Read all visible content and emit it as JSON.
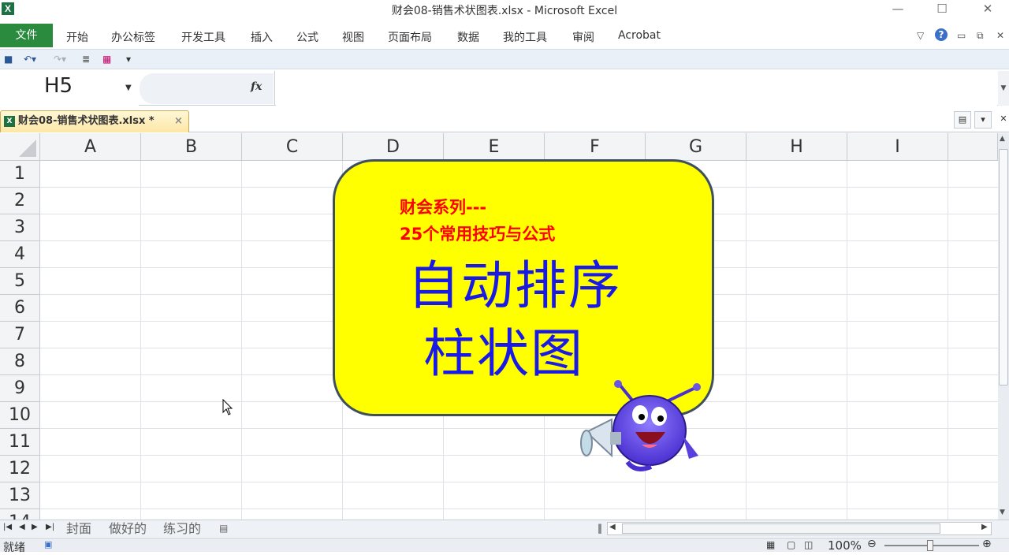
{
  "window": {
    "title": "财会08-销售术状图表.xlsx - Microsoft Excel"
  },
  "ribbon": {
    "file_tab": "文件",
    "tabs": [
      "开始",
      "办公标签",
      "开发工具",
      "插入",
      "公式",
      "视图",
      "页面布局",
      "数据",
      "我的工具",
      "审阅",
      "Acrobat"
    ]
  },
  "formula_bar": {
    "name_box": "H5",
    "fx_label": "fx",
    "formula": ""
  },
  "document_tab": {
    "name": "财会08-销售术状图表.xlsx *"
  },
  "grid": {
    "columns": [
      "A",
      "B",
      "C",
      "D",
      "E",
      "F",
      "G",
      "H",
      "I"
    ],
    "rows": [
      "1",
      "2",
      "3",
      "4",
      "5",
      "6",
      "7",
      "8",
      "9",
      "10",
      "11",
      "12",
      "13",
      "14"
    ]
  },
  "callout": {
    "subtitle_line1": "财会系列---",
    "subtitle_line2": "25个常用技巧与公式",
    "title_line1": "自动排序",
    "title_line2": "柱状图",
    "fill_color": "#ffff00",
    "subtitle_color": "#ff0000",
    "title_color": "#1a1ae6"
  },
  "sheet_tabs": [
    "封面",
    "做好的",
    "练习的"
  ],
  "status": {
    "ready": "就绪",
    "zoom": "100%"
  },
  "colors": {
    "file_tab": "#2a8a3e",
    "excel_green": "#1e7145"
  }
}
